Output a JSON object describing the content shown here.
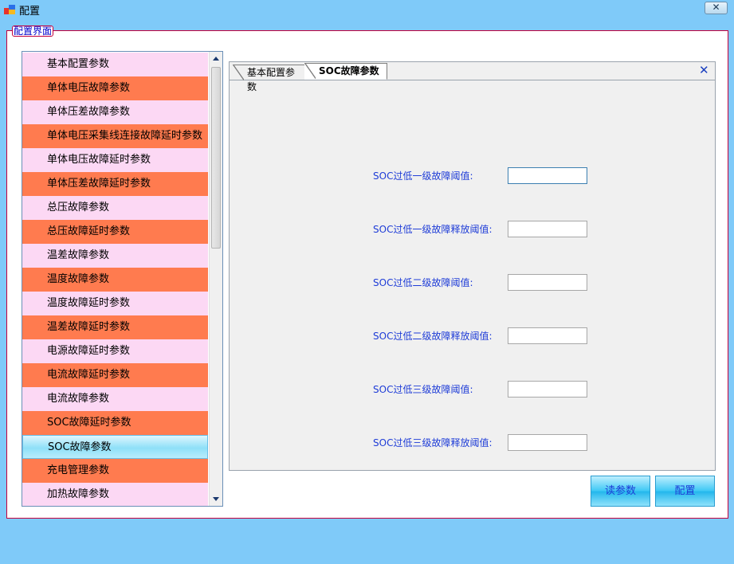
{
  "window": {
    "title": "配置",
    "close_glyph": "✕",
    "icon": "app-config-icon"
  },
  "group": {
    "label": "配置界面"
  },
  "param_list": {
    "items": [
      {
        "label": "基本配置参数",
        "color": "pink"
      },
      {
        "label": "单体电压故障参数",
        "color": "orange"
      },
      {
        "label": "单体压差故障参数",
        "color": "pink"
      },
      {
        "label": "单体电压采集线连接故障延时参数",
        "color": "orange"
      },
      {
        "label": "单体电压故障延时参数",
        "color": "pink"
      },
      {
        "label": "单体压差故障延时参数",
        "color": "orange"
      },
      {
        "label": "总压故障参数",
        "color": "pink"
      },
      {
        "label": "总压故障延时参数",
        "color": "orange"
      },
      {
        "label": "温差故障参数",
        "color": "pink"
      },
      {
        "label": "温度故障参数",
        "color": "orange"
      },
      {
        "label": "温度故障延时参数",
        "color": "pink"
      },
      {
        "label": "温差故障延时参数",
        "color": "orange"
      },
      {
        "label": "电源故障延时参数",
        "color": "pink"
      },
      {
        "label": "电流故障延时参数",
        "color": "orange"
      },
      {
        "label": "电流故障参数",
        "color": "pink"
      },
      {
        "label": "SOC故障延时参数",
        "color": "orange"
      },
      {
        "label": "SOC故障参数",
        "color": "selected"
      },
      {
        "label": "充电管理参数",
        "color": "orange"
      },
      {
        "label": "加热故障参数",
        "color": "pink"
      }
    ],
    "selected_index": 16
  },
  "tabs": [
    {
      "label": "基本配置参数",
      "active": false
    },
    {
      "label": "SOC故障参数",
      "active": true
    }
  ],
  "tab_close_glyph": "✕",
  "fields": [
    {
      "label": "SOC过低一级故障阈值:",
      "value": ""
    },
    {
      "label": "SOC过低一级故障释放阈值:",
      "value": ""
    },
    {
      "label": "SOC过低二级故障阈值:",
      "value": ""
    },
    {
      "label": "SOC过低二级故障释放阈值:",
      "value": ""
    },
    {
      "label": "SOC过低三级故障阈值:",
      "value": ""
    },
    {
      "label": "SOC过低三级故障释放阈值:",
      "value": ""
    }
  ],
  "buttons": {
    "read_label": "读参数",
    "config_label": "配置"
  },
  "colors": {
    "window_bg": "#7fcaf9",
    "list_pink": "#fcd8f4",
    "list_orange": "#ff7b4f",
    "label_blue": "#1e3cd7",
    "frame_red": "#c4003c"
  }
}
